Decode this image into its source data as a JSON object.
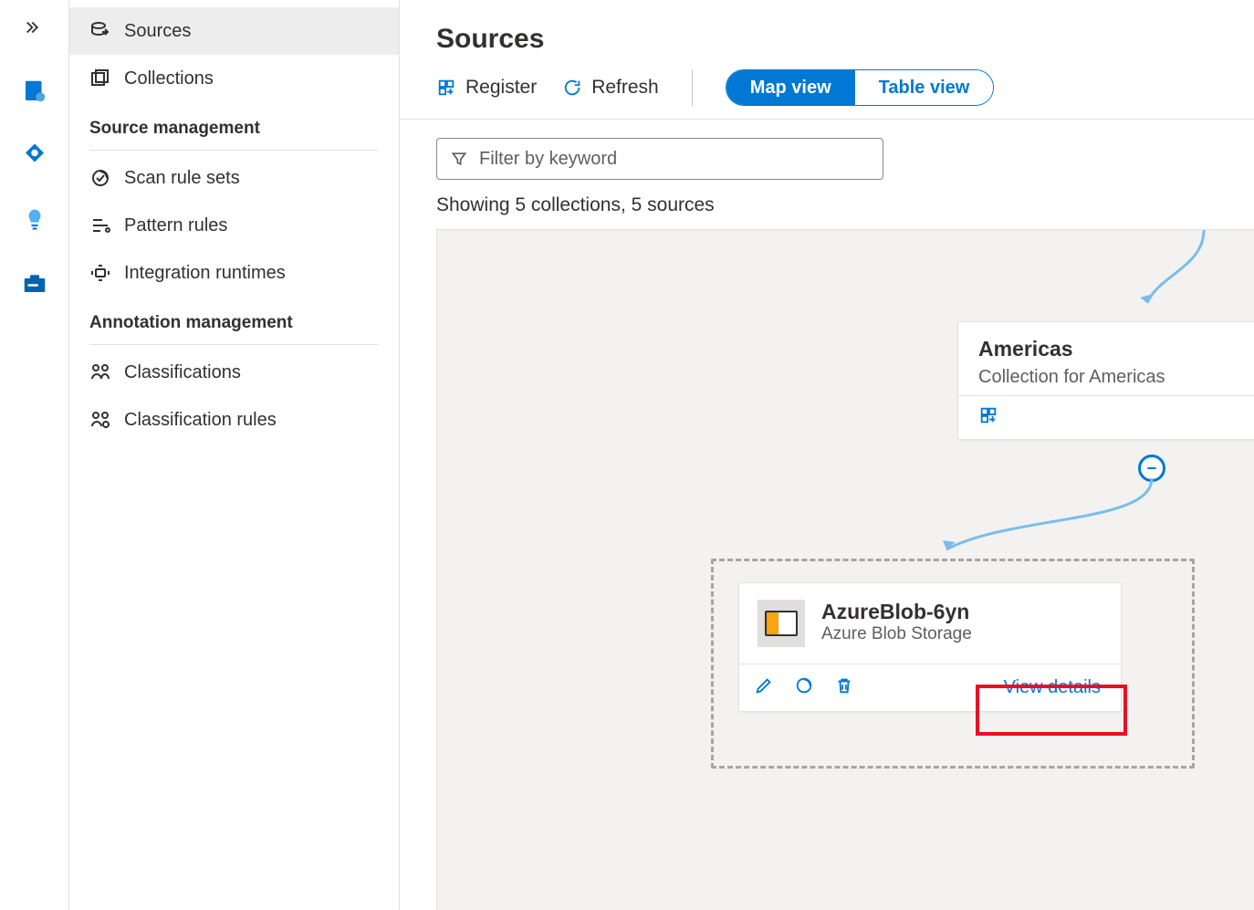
{
  "rail": {
    "expand_icon": "chevron-expand"
  },
  "sidebar": {
    "items": [
      {
        "label": "Sources",
        "active": true
      },
      {
        "label": "Collections",
        "active": false
      }
    ],
    "section1": "Source management",
    "section1_items": [
      {
        "label": "Scan rule sets"
      },
      {
        "label": "Pattern rules"
      },
      {
        "label": "Integration runtimes"
      }
    ],
    "section2": "Annotation management",
    "section2_items": [
      {
        "label": "Classifications"
      },
      {
        "label": "Classification rules"
      }
    ]
  },
  "header": {
    "title": "Sources"
  },
  "toolbar": {
    "register": "Register",
    "refresh": "Refresh",
    "map_view": "Map view",
    "table_view": "Table view"
  },
  "filter": {
    "placeholder": "Filter by keyword"
  },
  "showing": "Showing 5 collections, 5 sources",
  "collection": {
    "title": "Americas",
    "subtitle": "Collection for Americas"
  },
  "source": {
    "title": "AzureBlob-6yn",
    "subtitle": "Azure Blob Storage",
    "view_details": "View details"
  }
}
